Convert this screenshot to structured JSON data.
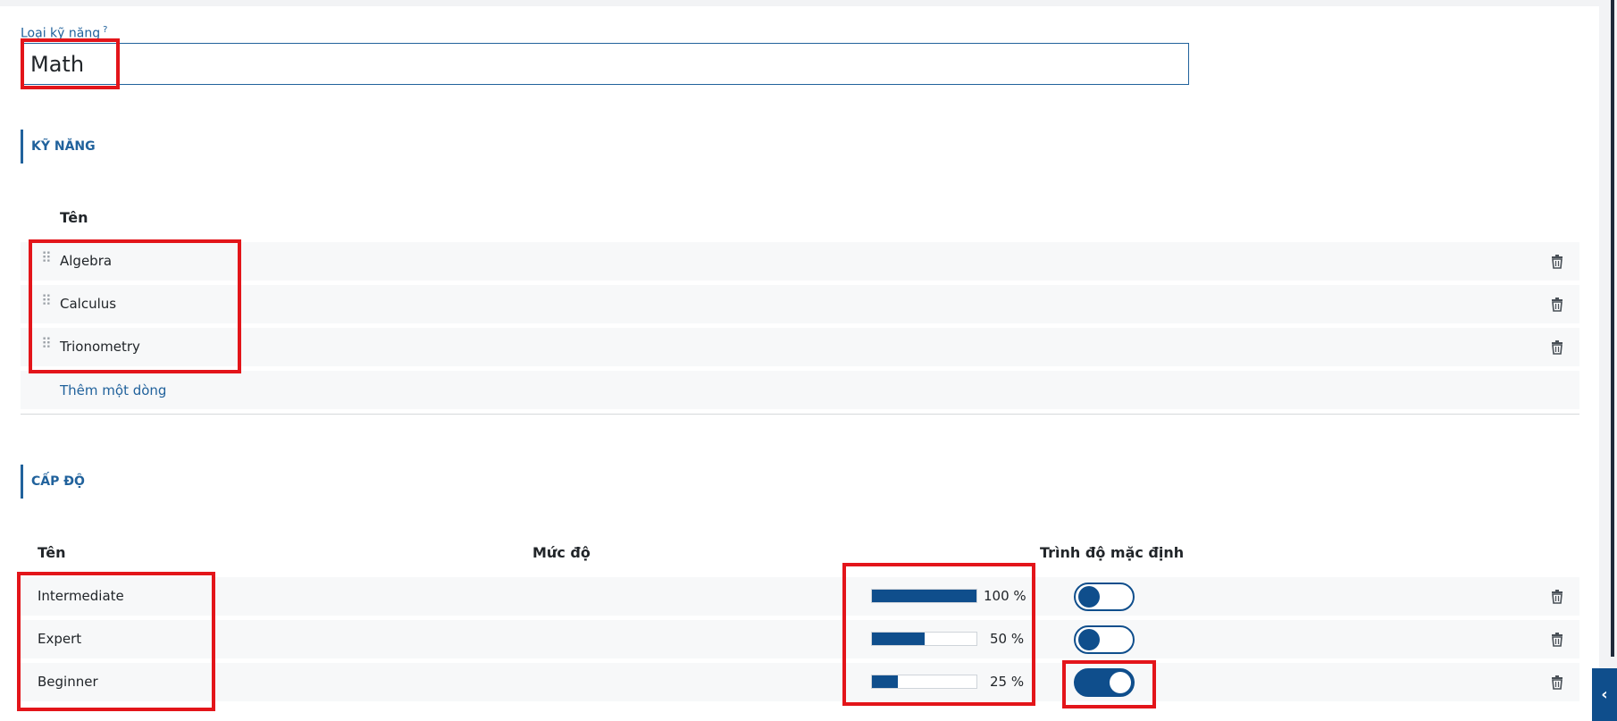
{
  "form": {
    "skill_type_label": "Loại kỹ năng",
    "skill_type_help": "?",
    "skill_type_value": "Math"
  },
  "skills_section": {
    "title": "KỸ NĂNG",
    "column_name": "Tên",
    "rows": [
      {
        "name": "Algebra"
      },
      {
        "name": "Calculus"
      },
      {
        "name": "Trionometry"
      }
    ],
    "add_line": "Thêm một dòng"
  },
  "levels_section": {
    "title": "CẤP ĐỘ",
    "column_name": "Tên",
    "column_level": "Mức độ",
    "column_default": "Trình độ mặc định",
    "rows": [
      {
        "name": "Intermediate",
        "progress": 100,
        "progress_label": "100 %",
        "default": false
      },
      {
        "name": "Expert",
        "progress": 50,
        "progress_label": "50 %",
        "default": false
      },
      {
        "name": "Beginner",
        "progress": 25,
        "progress_label": "25 %",
        "default": true
      }
    ]
  },
  "icons": {
    "drag": "drag-handle-icon",
    "delete": "trash-icon",
    "collapse": "chevron-left-icon"
  },
  "colors": {
    "accent": "#0f4e8c",
    "link": "#21629c",
    "highlight": "#e3151a"
  }
}
